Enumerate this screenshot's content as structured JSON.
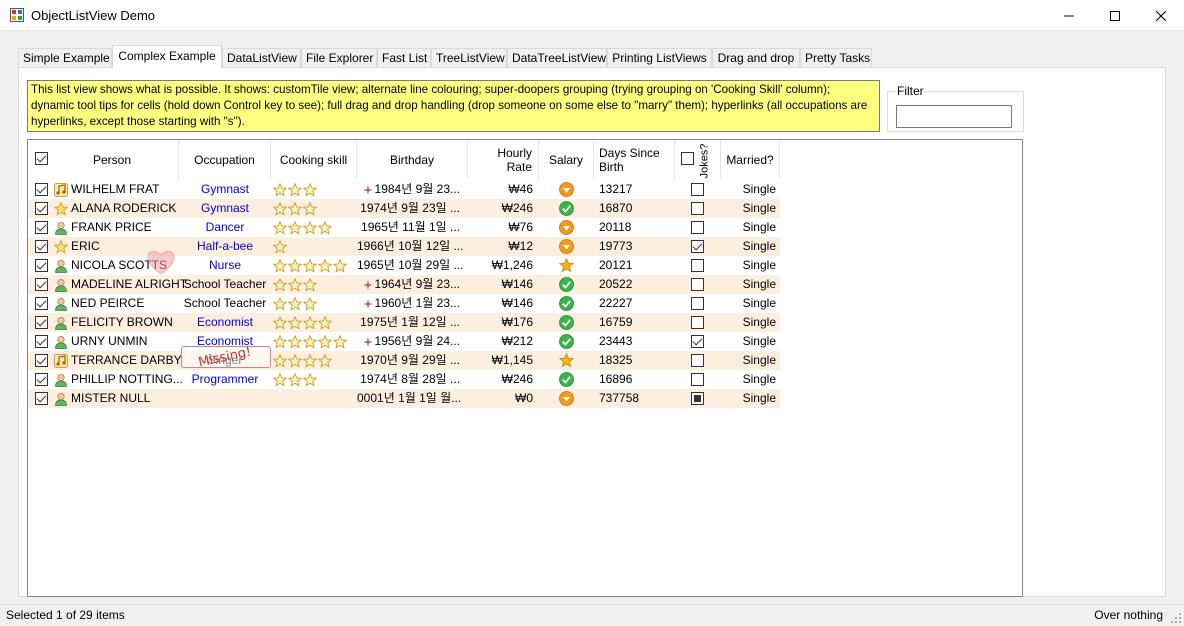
{
  "window": {
    "title": "ObjectListView Demo",
    "min_glyph": "—",
    "max_glyph": "☐",
    "close_glyph": "✕"
  },
  "tabs": [
    {
      "label": "Simple Example",
      "active": false
    },
    {
      "label": "Complex Example",
      "active": true
    },
    {
      "label": "DataListView",
      "active": false
    },
    {
      "label": "File Explorer",
      "active": false
    },
    {
      "label": "Fast List",
      "active": false
    },
    {
      "label": "TreeListView",
      "active": false
    },
    {
      "label": "DataTreeListView",
      "active": false
    },
    {
      "label": "Printing ListViews",
      "active": false
    },
    {
      "label": "Drag and drop",
      "active": false
    },
    {
      "label": "Pretty Tasks",
      "active": false
    }
  ],
  "description": "This list view shows what is possible. It shows: customTile view; alternate line colouring; super-doopers grouping (trying grouping on 'Cooking Skill' column); dynamic tool tips for cells (hold down Control key to see); full drag and drop handling (drop someone on some else to \"marry\" them); hyperlinks (all occupations are hyperlinks, except those starting with \"s\").",
  "filter": {
    "label": "Filter",
    "value": ""
  },
  "columns": {
    "person": "Person",
    "occupation": "Occupation",
    "cooking": "Cooking skill",
    "birthday": "Birthday",
    "hourly_line1": "Hourly",
    "hourly_line2": "Rate",
    "salary": "Salary",
    "days_line1": "Days Since",
    "days_line2": "Birth",
    "jokes": "Jokes?",
    "married": "Married?"
  },
  "rows": [
    {
      "name": "WILHELM FRAT",
      "icon": "music-icon",
      "occupation": "Gymnast",
      "link": true,
      "stars": 3,
      "birthday": "1984년 9월 23...",
      "bday_marker": true,
      "rate": "₩46",
      "salary": "down",
      "days": "13217",
      "jokes": "unchecked",
      "married": "Single"
    },
    {
      "name": "ALANA RODERICK",
      "icon": "star-icon",
      "occupation": "Gymnast",
      "link": true,
      "stars": 3,
      "birthday": "1974년 9월 23일 ...",
      "bday_marker": false,
      "rate": "₩246",
      "salary": "ok",
      "days": "16870",
      "jokes": "unchecked",
      "married": "Single"
    },
    {
      "name": "FRANK PRICE",
      "icon": "person-icon",
      "occupation": "Dancer",
      "link": true,
      "stars": 4,
      "birthday": "1965년 11월 1일 ...",
      "bday_marker": false,
      "rate": "₩76",
      "salary": "down",
      "days": "20118",
      "jokes": "unchecked",
      "married": "Single"
    },
    {
      "name": "ERIC",
      "icon": "star-icon",
      "occupation": "Half-a-bee",
      "link": true,
      "stars": 1,
      "birthday": "1966년 10월 12일 ...",
      "bday_marker": false,
      "rate": "₩12",
      "salary": "down",
      "days": "19773",
      "jokes": "checked",
      "married": "Single"
    },
    {
      "name": "NICOLA SCOTTS",
      "icon": "person-icon",
      "occupation": "Nurse",
      "link": true,
      "stars": 5,
      "birthday": "1965년 10월 29일 ...",
      "bday_marker": false,
      "rate": "₩1,246",
      "salary": "star",
      "days": "20121",
      "jokes": "unchecked",
      "married": "Single"
    },
    {
      "name": "MADELINE ALRIGHT",
      "icon": "person-icon",
      "occupation": "School Teacher",
      "link": false,
      "stars": 3,
      "birthday": "1964년 9월 23...",
      "bday_marker": true,
      "rate": "₩146",
      "salary": "ok",
      "days": "20522",
      "jokes": "unchecked",
      "married": "Single"
    },
    {
      "name": "NED PEIRCE",
      "icon": "person-icon",
      "occupation": "School Teacher",
      "link": false,
      "stars": 3,
      "birthday": "1960년 1월 23...",
      "bday_marker": true,
      "rate": "₩146",
      "salary": "ok",
      "days": "22227",
      "jokes": "unchecked",
      "married": "Single"
    },
    {
      "name": "FELICITY BROWN",
      "icon": "person-icon",
      "occupation": "Economist",
      "link": true,
      "stars": 4,
      "birthday": "1975년 1월 12일 ...",
      "bday_marker": false,
      "rate": "₩176",
      "salary": "ok",
      "days": "16759",
      "jokes": "unchecked",
      "married": "Single"
    },
    {
      "name": "URNY UNMIN",
      "icon": "person-icon",
      "occupation": "Economist",
      "link": true,
      "stars": 5,
      "birthday": "1956년 9월 24...",
      "bday_marker": true,
      "rate": "₩212",
      "salary": "ok",
      "days": "23443",
      "jokes": "checked",
      "married": "Single"
    },
    {
      "name": "TERRANCE DARBY",
      "icon": "music-icon",
      "occupation": "Singer",
      "link": false,
      "stars": 4,
      "birthday": "1970년 9월 29일 ...",
      "bday_marker": false,
      "rate": "₩1,145",
      "salary": "star",
      "days": "18325",
      "jokes": "unchecked",
      "married": "Single"
    },
    {
      "name": "PHILLIP NOTTING...",
      "icon": "person-icon",
      "occupation": "Programmer",
      "link": true,
      "stars": 3,
      "birthday": "1974년 8월 28일 ...",
      "bday_marker": false,
      "rate": "₩246",
      "salary": "ok",
      "days": "16896",
      "jokes": "unchecked",
      "married": "Single"
    },
    {
      "name": "MISTER NULL",
      "icon": "person-icon",
      "occupation": "",
      "link": false,
      "stars": 0,
      "birthday": "0001년 1월 1일 월...",
      "bday_marker": false,
      "rate": "₩0",
      "salary": "down",
      "days": "737758",
      "jokes": "indeterminate",
      "married": "Single"
    }
  ],
  "missing_label": "Missing!",
  "status": {
    "left": "Selected 1 of 29 items",
    "right": "Over nothing"
  },
  "colors": {
    "description_bg": "#ffff80",
    "alt_row": "#fdefe0",
    "link": "#0000e0",
    "missing": "#c03030"
  }
}
